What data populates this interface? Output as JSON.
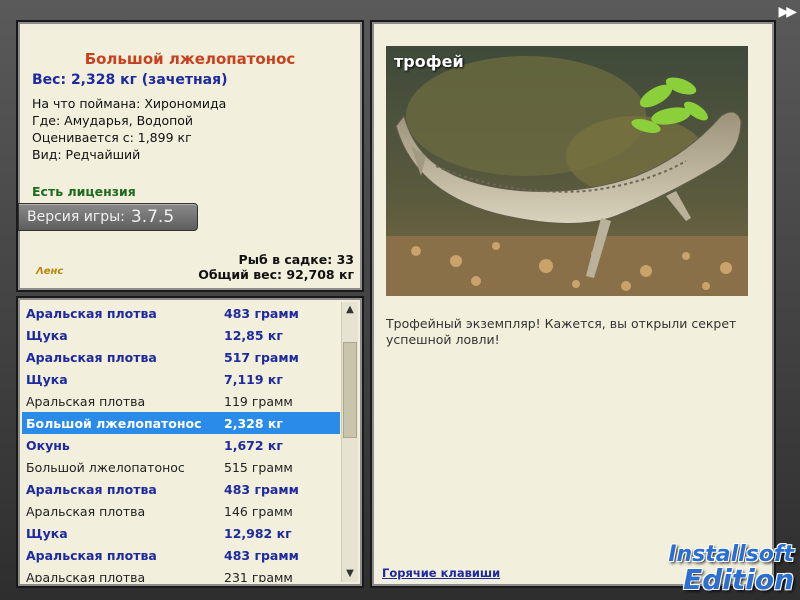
{
  "window": {
    "fast_forward_label": "▶▶"
  },
  "catch": {
    "title": "Большой лжелопатонос",
    "weight_line": "Вес: 2,328 кг (зачетная)",
    "bait": "На что поймана: Хирономида",
    "location": "Где: Амударья, Водопой",
    "rated_from": "Оценивается с: 1,899 кг",
    "kind": "Вид: Редчайший",
    "license": "Есть лицензия"
  },
  "version": {
    "label": "Версия игры:",
    "number": "3.7.5"
  },
  "small_logo": "Λенс",
  "stats": {
    "keepnet": "Рыб в садке: 33",
    "total": "Общий вес: 92,708 кг"
  },
  "fish_list": [
    {
      "name": "Аральская плотва",
      "weight": "483 грамм",
      "style": "hl"
    },
    {
      "name": "Щука",
      "weight": "12,85 кг",
      "style": "hl"
    },
    {
      "name": "Аральская плотва",
      "weight": "517 грамм",
      "style": "hl"
    },
    {
      "name": "Щука",
      "weight": "7,119 кг",
      "style": "hl"
    },
    {
      "name": "Аральская плотва",
      "weight": "119 грамм",
      "style": "plain"
    },
    {
      "name": "Большой лжелопатонос",
      "weight": "2,328 кг",
      "style": "sel"
    },
    {
      "name": "Окунь",
      "weight": "1,672 кг",
      "style": "hl"
    },
    {
      "name": "Большой лжелопатонос",
      "weight": "515 грамм",
      "style": "plain"
    },
    {
      "name": "Аральская плотва",
      "weight": "483 грамм",
      "style": "hl"
    },
    {
      "name": "Аральская плотва",
      "weight": "146 грамм",
      "style": "plain"
    },
    {
      "name": "Щука",
      "weight": "12,982 кг",
      "style": "hl"
    },
    {
      "name": "Аральская плотва",
      "weight": "483 грамм",
      "style": "hl"
    },
    {
      "name": "Аральская плотва",
      "weight": "231 грамм",
      "style": "plain"
    }
  ],
  "trophy": {
    "photo_label": "трофей",
    "description": "Трофейный экземпляр! Кажется, вы открыли секрет успешной ловли!",
    "hotkeys_link": "Горячие клавиши"
  },
  "watermark": {
    "line1": "Installsoft",
    "line2": "Edition"
  },
  "colors": {
    "panel_bg": "#f2efdc",
    "selection": "#2a8be8",
    "highlight_text": "#1e2aa0",
    "title_text": "#c8411f",
    "license_text": "#1e6a1e"
  }
}
